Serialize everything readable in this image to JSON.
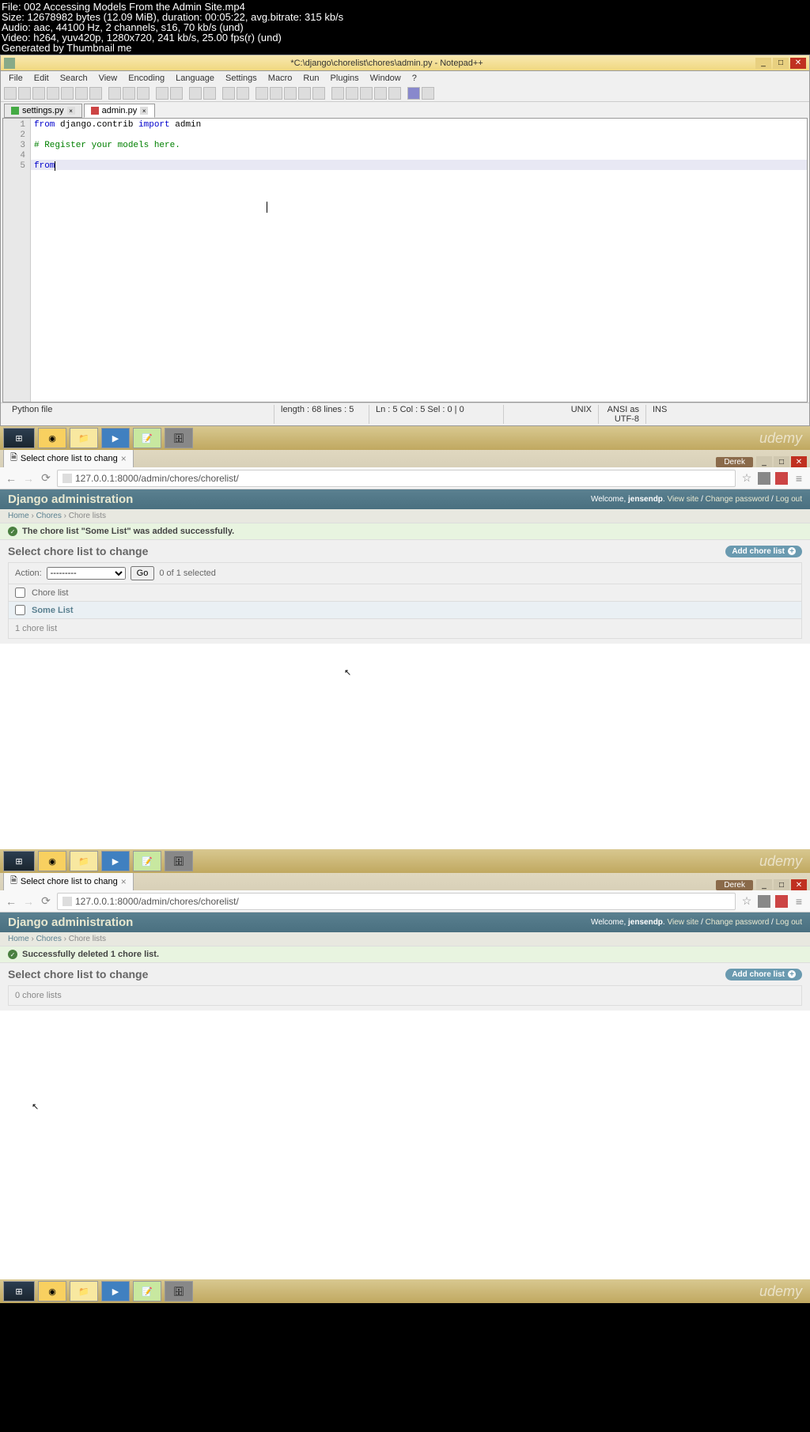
{
  "video_info": {
    "line1": "File: 002 Accessing Models From the Admin Site.mp4",
    "line2": "Size: 12678982 bytes (12.09 MiB), duration: 00:05:22, avg.bitrate: 315 kb/s",
    "line3": "Audio: aac, 44100 Hz, 2 channels, s16, 70 kb/s (und)",
    "line4": "Video: h264, yuv420p, 1280x720, 241 kb/s, 25.00 fps(r) (und)",
    "line5": "Generated by Thumbnail me"
  },
  "notepad": {
    "title": "*C:\\django\\chorelist\\chores\\admin.py - Notepad++",
    "menu": [
      "File",
      "Edit",
      "Search",
      "View",
      "Encoding",
      "Language",
      "Settings",
      "Macro",
      "Run",
      "Plugins",
      "Window",
      "?"
    ],
    "tabs": [
      {
        "label": "settings.py",
        "active": false
      },
      {
        "label": "admin.py",
        "active": true
      }
    ],
    "code": {
      "line1_from": "from",
      "line1_mod": " django.contrib ",
      "line1_import": "import",
      "line1_admin": " admin",
      "line3": "# Register your models here.",
      "line5": "from"
    },
    "status": {
      "type": "Python file",
      "length": "length : 68   lines : 5",
      "pos": "Ln : 5   Col : 5   Sel : 0 | 0",
      "eol": "UNIX",
      "enc": "ANSI as UTF-8",
      "mode": "INS"
    }
  },
  "chrome1": {
    "tab_title": "Select chore list to chang",
    "user": "Derek",
    "url": "127.0.0.1:8000/admin/chores/chorelist/"
  },
  "chrome2": {
    "tab_title": "Select chore list to chang",
    "user": "Derek",
    "url": "127.0.0.1:8000/admin/chores/chorelist/"
  },
  "django": {
    "title": "Django administration",
    "welcome": "Welcome, ",
    "username": "jensendp",
    "links": {
      "view": "View site",
      "change": "Change password",
      "logout": "Log out"
    },
    "breadcrumb": {
      "home": "Home",
      "chores": "Chores",
      "chorelists": "Chore lists"
    }
  },
  "section1": {
    "success": "The chore list \"Some List\" was added successfully.",
    "heading": "Select chore list to change",
    "add_btn": "Add chore list",
    "action_label": "Action:",
    "action_selected": "---------",
    "go": "Go",
    "selected": "0 of 1 selected",
    "th": "Chore list",
    "row": "Some List",
    "count": "1 chore list"
  },
  "section2": {
    "success": "Successfully deleted 1 chore list.",
    "heading": "Select chore list to change",
    "add_btn": "Add chore list",
    "count": "0 chore lists"
  },
  "watermark": "udemy"
}
